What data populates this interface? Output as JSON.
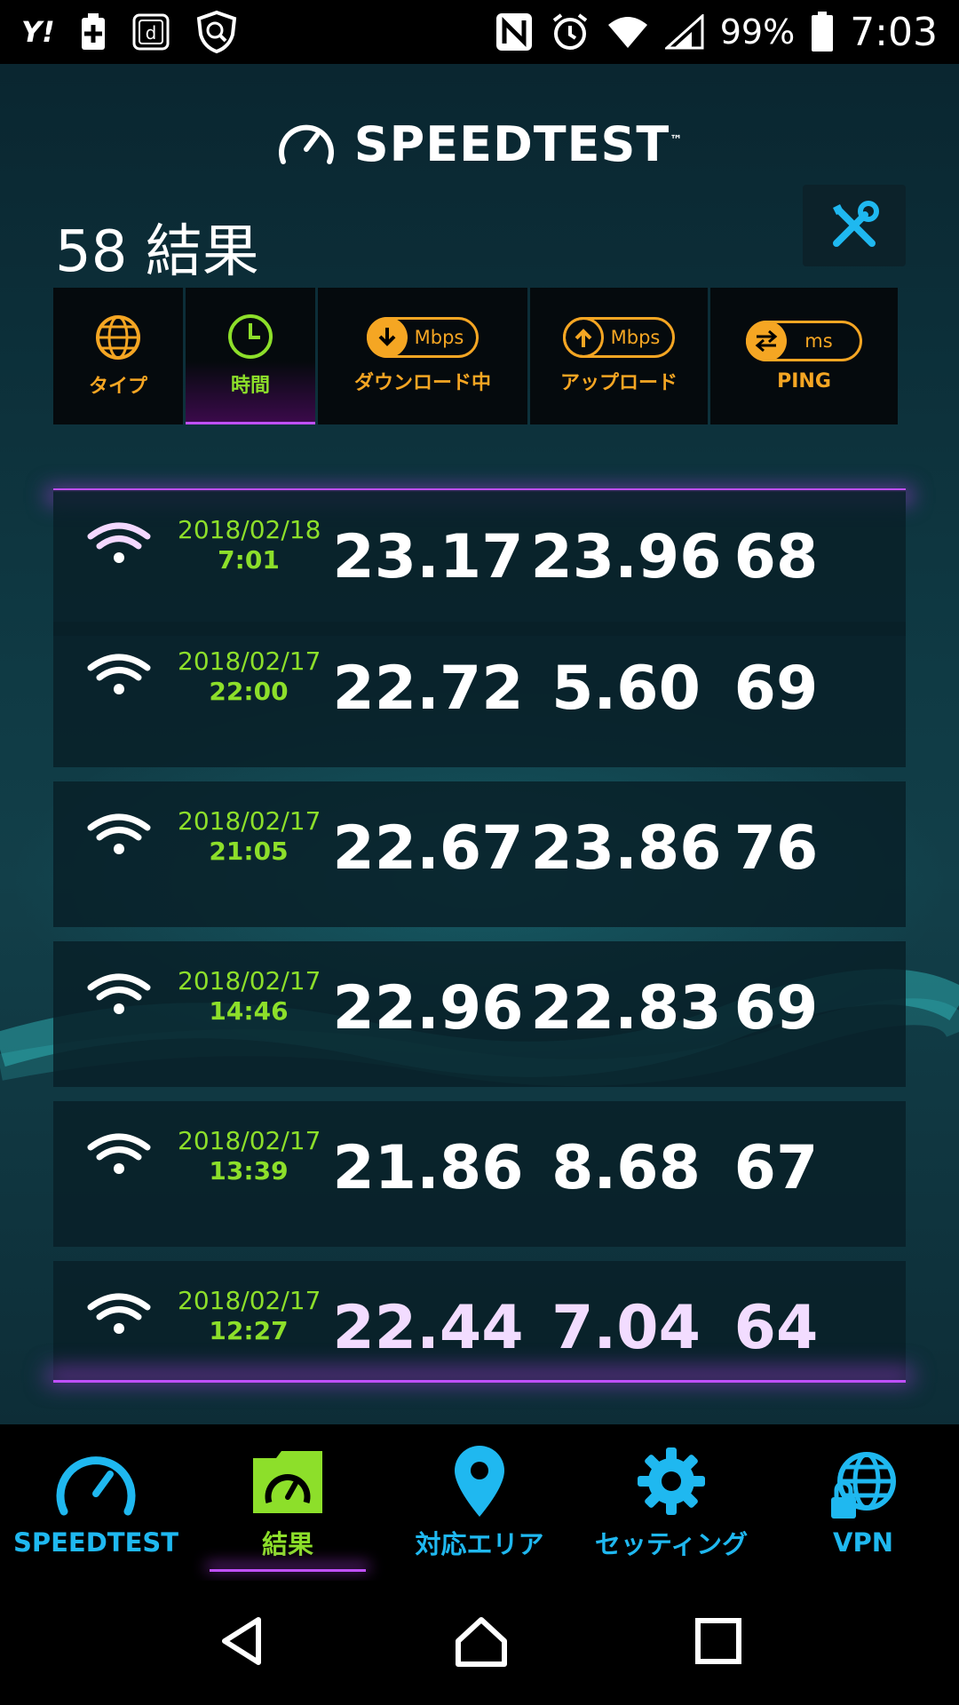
{
  "status_bar": {
    "left_icons": [
      "yahoo-icon",
      "plus-app-icon",
      "d-app-icon",
      "shield-search-icon"
    ],
    "yahoo_text": "Y!",
    "right_icons": [
      "nfc-icon",
      "alarm-icon",
      "wifi-icon",
      "signal-icon",
      "battery-icon"
    ],
    "battery": "99%",
    "time": "7:03"
  },
  "app": {
    "brand": "SPEEDTEST",
    "tm": "™",
    "results_count": "58 結果"
  },
  "sort_bar": {
    "columns": [
      {
        "label": "タイプ",
        "icon": "globe-icon"
      },
      {
        "label": "時間",
        "icon": "clock-icon"
      },
      {
        "label": "ダウンロード中",
        "icon": "download-icon",
        "unit": "Mbps"
      },
      {
        "label": "アップロード",
        "icon": "upload-icon",
        "unit": "Mbps"
      },
      {
        "label": "PING",
        "icon": "ping-icon",
        "unit": "ms"
      }
    ],
    "active": "時間"
  },
  "results": [
    {
      "date": "2018/02/18",
      "time": "7:01",
      "download": "23.17",
      "upload": "23.96",
      "ping": "68"
    },
    {
      "date": "2018/02/17",
      "time": "22:00",
      "download": "22.72",
      "upload": "5.60",
      "ping": "69"
    },
    {
      "date": "2018/02/17",
      "time": "21:05",
      "download": "22.67",
      "upload": "23.86",
      "ping": "76"
    },
    {
      "date": "2018/02/17",
      "time": "14:46",
      "download": "22.96",
      "upload": "22.83",
      "ping": "69"
    },
    {
      "date": "2018/02/17",
      "time": "13:39",
      "download": "21.86",
      "upload": "8.68",
      "ping": "67"
    },
    {
      "date": "2018/02/17",
      "time": "12:27",
      "download": "22.44",
      "upload": "7.04",
      "ping": "64"
    }
  ],
  "bottom_nav": [
    {
      "label": "SPEEDTEST",
      "icon": "speedometer-icon"
    },
    {
      "label": "結果",
      "icon": "results-folder-icon"
    },
    {
      "label": "対応エリア",
      "icon": "map-pin-icon"
    },
    {
      "label": "セッティング",
      "icon": "gear-icon"
    },
    {
      "label": "VPN",
      "icon": "vpn-globe-lock-icon"
    }
  ],
  "colors": {
    "accent_blue": "#1fb8f0",
    "accent_green": "#8ddf2a",
    "accent_orange": "#f5a623",
    "accent_purple": "#c050ff"
  }
}
